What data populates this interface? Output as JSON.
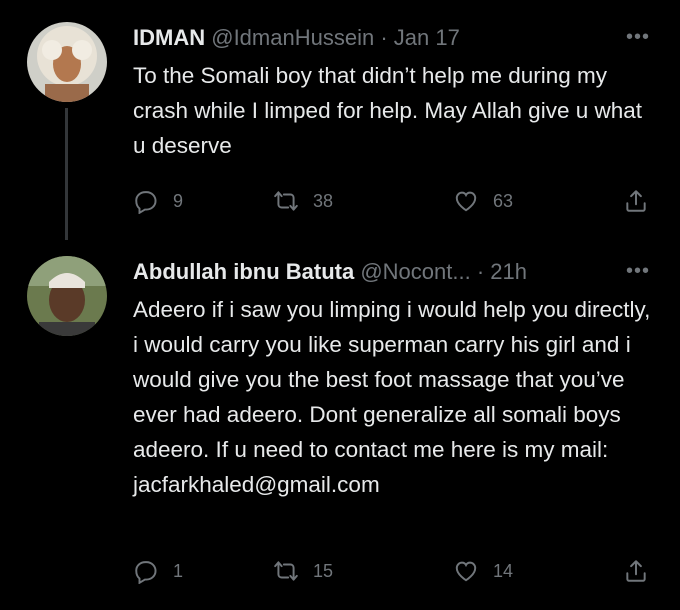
{
  "tweets": [
    {
      "name": "IDMAN",
      "handle": "@IdmanHussein",
      "separator": "·",
      "time": "Jan 17",
      "text": "To the Somali boy that didn’t help me during my crash while I limped for help. May Allah give u what u deserve",
      "replies": "9",
      "retweets": "38",
      "likes": "63"
    },
    {
      "name": "Abdullah ibnu Batuta",
      "handle": "@Nocont...",
      "separator": "·",
      "time": "21h",
      "text": "Adeero if i saw you limping i would help you directly, i would carry you like superman carry his girl and i would give you the best foot massage that you’ve ever had adeero. Dont generalize all somali boys adeero. If u need to contact me here is my mail: jacfarkhaled@gmail.com",
      "replies": "1",
      "retweets": "15",
      "likes": "14"
    }
  ],
  "more_label": "•••",
  "colors": {
    "background": "#000000",
    "text": "#e7e9ea",
    "muted": "#71767b",
    "thread_line": "#333639"
  }
}
